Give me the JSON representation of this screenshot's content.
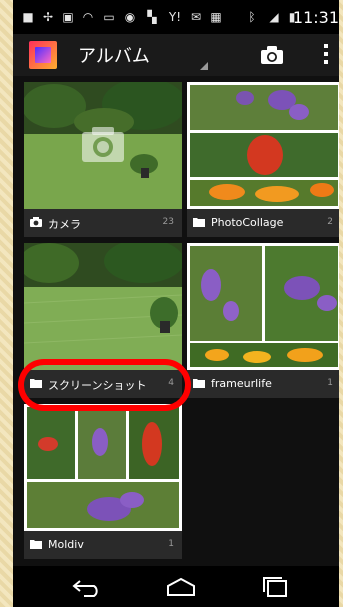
{
  "status_bar": {
    "time": "11:31",
    "icons": [
      "notification-icon",
      "cutlery-icon",
      "photo-icon",
      "wifi-icon",
      "screen-icon",
      "game-icon",
      "flash-icon",
      "yahoo-icon",
      "mail-icon",
      "calendar-icon",
      "bluetooth-icon",
      "signal-icon",
      "battery-icon"
    ],
    "yahoo_text": "Y!"
  },
  "action_bar": {
    "title": "アルバム",
    "icons": [
      "app-icon",
      "camera-icon",
      "overflow-menu-icon"
    ]
  },
  "albums": [
    {
      "label": "カメラ",
      "count": "23",
      "icon": "camera-icon"
    },
    {
      "label": "PhotoCollage",
      "count": "2",
      "icon": "folder-icon"
    },
    {
      "label": "スクリーンショット",
      "count": "4",
      "icon": "folder-icon"
    },
    {
      "label": "frameurlife",
      "count": "1",
      "icon": "folder-icon"
    },
    {
      "label": "Moldiv",
      "count": "1",
      "icon": "folder-icon"
    }
  ],
  "nav_bar": {
    "icons": [
      "back-icon",
      "home-icon",
      "recent-apps-icon"
    ]
  },
  "colors": {
    "action_bar": "#1a1a1a",
    "background": "#101010",
    "caption_bar": "#2a2a2a",
    "annotation": "#ff0000",
    "frame": "#eadcae"
  }
}
